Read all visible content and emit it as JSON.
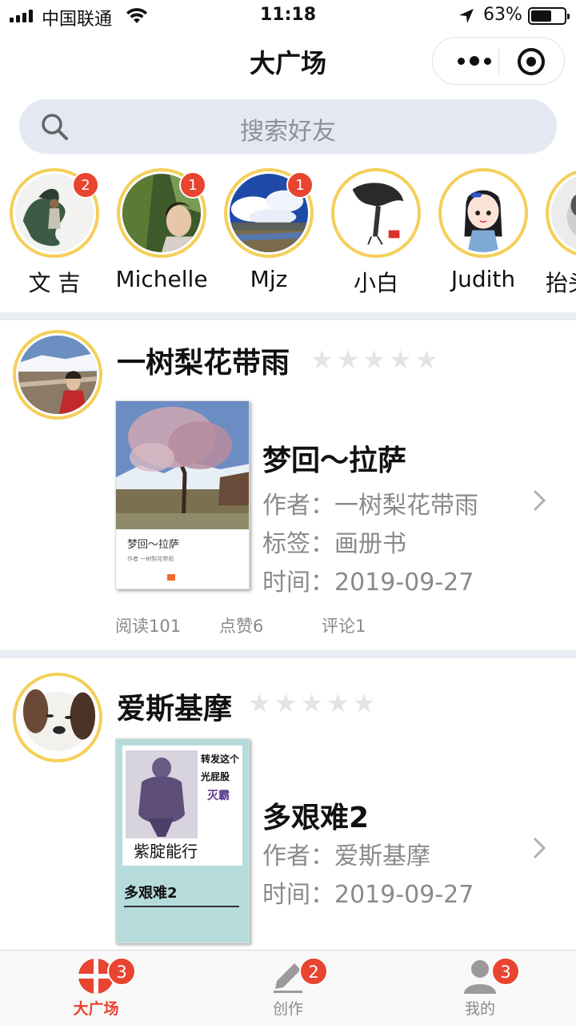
{
  "status_bar": {
    "carrier": "中国联通",
    "time": "11:18",
    "battery": "63%",
    "battery_level": 0.63
  },
  "header": {
    "title": "大广场"
  },
  "search": {
    "placeholder": "搜索好友"
  },
  "stories": [
    {
      "name": "文 吉",
      "badge": "2"
    },
    {
      "name": "Michelle",
      "badge": "1"
    },
    {
      "name": "Mjz",
      "badge": "1"
    },
    {
      "name": "小白",
      "badge": ""
    },
    {
      "name": "Judith",
      "badge": ""
    },
    {
      "name": "抬头",
      "badge": ""
    }
  ],
  "feed": [
    {
      "user": "一树梨花带雨",
      "rating": 0,
      "book_title": "梦回～拉萨",
      "cover_title": "梦回～拉萨",
      "cover_author": "作者 一树梨花带雨",
      "author_line": "作者：一树梨花带雨",
      "tag_line": "标签：画册书",
      "time_line": "时间：2019-09-27",
      "stats": {
        "reads": "阅读101",
        "likes": "点赞6",
        "comments": "评论1"
      }
    },
    {
      "user": "爱斯基摩",
      "rating": 0,
      "book_title": "多艰难2",
      "cover_title": "多艰难2",
      "cover_caption_1": "转发这个",
      "cover_caption_2": "光屁股",
      "cover_caption_3": "灭霸",
      "cover_caption_4": "紫腚能行",
      "author_line": "作者：爱斯基摩",
      "time_line": "时间：2019-09-27"
    }
  ],
  "tabbar": {
    "items": [
      {
        "label": "大广场",
        "badge": "3",
        "active": true
      },
      {
        "label": "创作",
        "badge": "2",
        "active": false
      },
      {
        "label": "我的",
        "badge": "3",
        "active": false
      }
    ]
  },
  "colors": {
    "accent": "#e84430",
    "ring": "#f5cf5a",
    "search_bg": "#e3e8f2",
    "divider": "#e8edf3"
  }
}
